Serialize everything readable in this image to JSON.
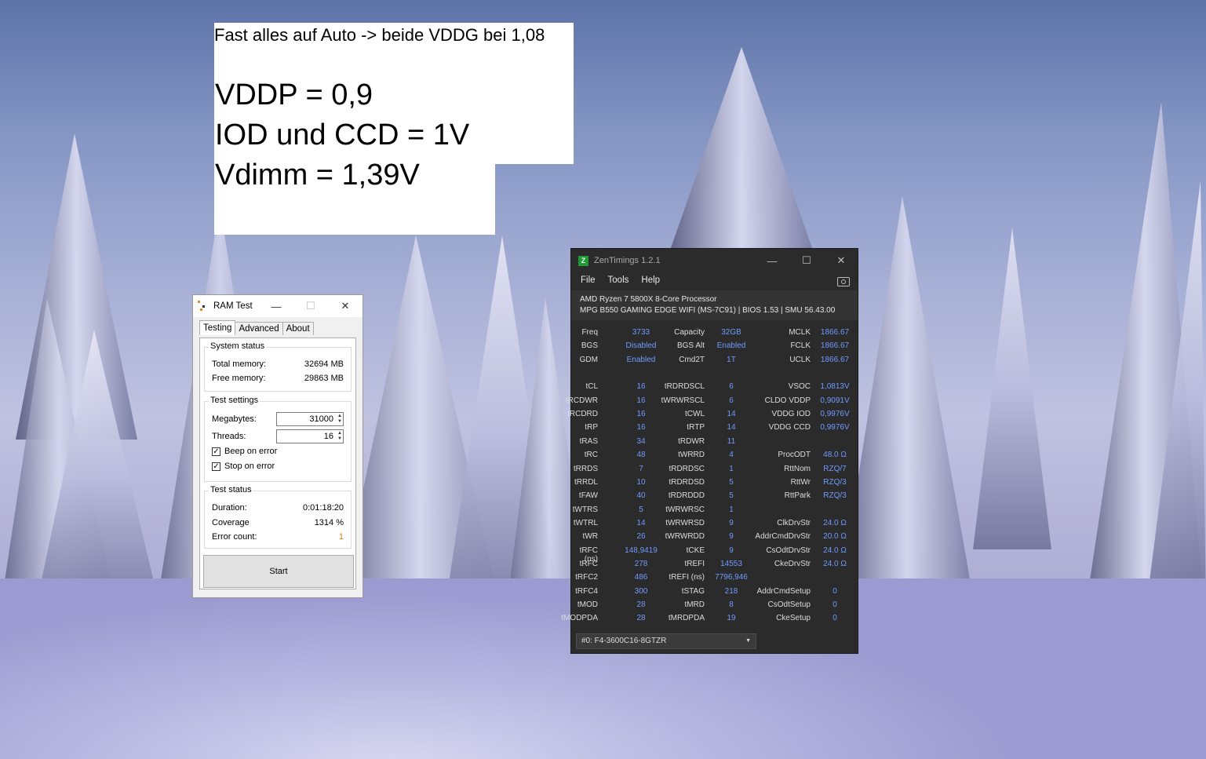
{
  "note": {
    "line1": "Fast alles auf Auto -> beide VDDG bei 1,08",
    "line2": "VDDP = 0,9",
    "line3": "IOD und CCD = 1V",
    "line4": "Vdimm = 1,39V"
  },
  "ramtest": {
    "title": "RAM Test",
    "tabs": [
      "Testing",
      "Advanced",
      "About"
    ],
    "system_status": {
      "label": "System status",
      "total_label": "Total memory:",
      "total_value": "32694 MB",
      "free_label": "Free memory:",
      "free_value": "29863 MB"
    },
    "test_settings": {
      "label": "Test settings",
      "megabytes_label": "Megabytes:",
      "megabytes_value": "31000",
      "threads_label": "Threads:",
      "threads_value": "16",
      "beep_label": "Beep on error",
      "beep_checked": true,
      "stop_label": "Stop on error",
      "stop_checked": true
    },
    "test_status": {
      "label": "Test status",
      "duration_label": "Duration:",
      "duration_value": "0:01:18:20",
      "coverage_label": "Coverage",
      "coverage_value": "1314 %",
      "errors_label": "Error count:",
      "errors_value": "1"
    },
    "start_label": "Start",
    "error_color": "#e07d10"
  },
  "zen": {
    "title": "ZenTimings 1.2.1",
    "menu": [
      "File",
      "Tools",
      "Help"
    ],
    "cpu": "AMD Ryzen 7 5800X 8-Core Processor",
    "board": "MPG B550 GAMING EDGE WIFI (MS-7C91) | BIOS 1.53 | SMU 56.43.00",
    "col1": [
      [
        "Freq",
        "3733"
      ],
      [
        "BGS",
        "Disabled"
      ],
      [
        "GDM",
        "Enabled"
      ],
      [
        "",
        ""
      ],
      [
        "tCL",
        "16"
      ],
      [
        "tRCDWR",
        "16"
      ],
      [
        "tRCDRD",
        "16"
      ],
      [
        "tRP",
        "16"
      ],
      [
        "tRAS",
        "34"
      ],
      [
        "tRC",
        "48"
      ],
      [
        "tRRDS",
        "7"
      ],
      [
        "tRRDL",
        "10"
      ],
      [
        "tFAW",
        "40"
      ],
      [
        "tWTRS",
        "5"
      ],
      [
        "tWTRL",
        "14"
      ],
      [
        "tWR",
        "26"
      ],
      [
        "tRFC (ns)",
        "148,9419"
      ],
      [
        "tRFC",
        "278"
      ],
      [
        "tRFC2",
        "486"
      ],
      [
        "tRFC4",
        "300"
      ],
      [
        "tMOD",
        "28"
      ],
      [
        "tMODPDA",
        "28"
      ]
    ],
    "col2": [
      [
        "Capacity",
        "32GB"
      ],
      [
        "BGS Alt",
        "Enabled"
      ],
      [
        "Cmd2T",
        "1T"
      ],
      [
        "",
        ""
      ],
      [
        "tRDRDSCL",
        "6"
      ],
      [
        "tWRWRSCL",
        "6"
      ],
      [
        "tCWL",
        "14"
      ],
      [
        "tRTP",
        "14"
      ],
      [
        "tRDWR",
        "11"
      ],
      [
        "tWRRD",
        "4"
      ],
      [
        "tRDRDSC",
        "1"
      ],
      [
        "tRDRDSD",
        "5"
      ],
      [
        "tRDRDDD",
        "5"
      ],
      [
        "tWRWRSC",
        "1"
      ],
      [
        "tWRWRSD",
        "9"
      ],
      [
        "tWRWRDD",
        "9"
      ],
      [
        "tCKE",
        "9"
      ],
      [
        "tREFI",
        "14553"
      ],
      [
        "tREFI (ns)",
        "7796,946"
      ],
      [
        "tSTAG",
        "218"
      ],
      [
        "tMRD",
        "8"
      ],
      [
        "tMRDPDA",
        "19"
      ]
    ],
    "col3": [
      [
        "MCLK",
        "1866.67"
      ],
      [
        "FCLK",
        "1866.67"
      ],
      [
        "UCLK",
        "1866.67"
      ],
      [
        "",
        ""
      ],
      [
        "VSOC",
        "1,0813V"
      ],
      [
        "CLDO VDDP",
        "0,9091V"
      ],
      [
        "VDDG IOD",
        "0,9976V"
      ],
      [
        "VDDG CCD",
        "0,9976V"
      ],
      [
        "",
        ""
      ],
      [
        "ProcODT",
        "48.0 Ω"
      ],
      [
        "RttNom",
        "RZQ/7"
      ],
      [
        "RttWr",
        "RZQ/3"
      ],
      [
        "RttPark",
        "RZQ/3"
      ],
      [
        "",
        ""
      ],
      [
        "ClkDrvStr",
        "24.0 Ω"
      ],
      [
        "AddrCmdDrvStr",
        "20.0 Ω"
      ],
      [
        "CsOdtDrvStr",
        "24.0 Ω"
      ],
      [
        "CkeDrvStr",
        "24.0 Ω"
      ],
      [
        "",
        ""
      ],
      [
        "AddrCmdSetup",
        "0"
      ],
      [
        "CsOdtSetup",
        "0"
      ],
      [
        "CkeSetup",
        "0"
      ]
    ],
    "module": "#0: F4-3600C16-8GTZR",
    "value_color": "#6f9bff"
  }
}
